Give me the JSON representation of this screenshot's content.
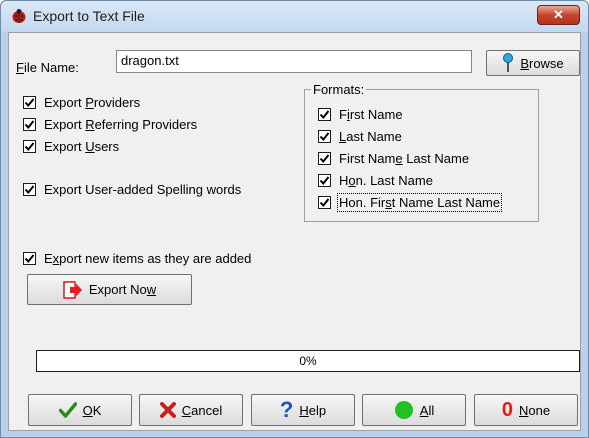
{
  "window": {
    "title": "Export to Text File",
    "close_label": "✕"
  },
  "file": {
    "label_prefix": "",
    "label_accel": "F",
    "label_rest": "ile Name:",
    "value": "dragon.txt"
  },
  "browse": {
    "accel": "B",
    "rest": "rowse"
  },
  "exports": [
    {
      "pre": "Export ",
      "accel": "P",
      "post": "roviders",
      "checked": true
    },
    {
      "pre": "Export ",
      "accel": "R",
      "post": "eferring Providers",
      "checked": true
    },
    {
      "pre": "Export ",
      "accel": "U",
      "post": "sers",
      "checked": true
    },
    {
      "pre": "Export User-added Spellin",
      "accel": "g",
      "post": " words",
      "checked": true
    }
  ],
  "formats": {
    "title": "Formats:",
    "items": [
      {
        "pre": "F",
        "accel": "i",
        "post": "rst Name",
        "checked": true
      },
      {
        "pre": "",
        "accel": "L",
        "post": "ast Name",
        "checked": true
      },
      {
        "pre": "First Nam",
        "accel": "e",
        "post": " Last Name",
        "checked": true
      },
      {
        "pre": "H",
        "accel": "o",
        "post": "n. Last Name",
        "checked": true
      },
      {
        "pre": "Hon. Fir",
        "accel": "s",
        "post": "t Name Last Name",
        "checked": true
      }
    ]
  },
  "export_new": {
    "pre": "E",
    "accel": "x",
    "post": "port new items as they are added",
    "checked": true
  },
  "export_now": {
    "pre": "Export No",
    "accel": "w",
    "post": ""
  },
  "progress": {
    "value": 0,
    "text": "0%"
  },
  "buttons": {
    "ok": {
      "accel": "O",
      "rest": "K"
    },
    "cancel": {
      "accel": "C",
      "rest": "ancel"
    },
    "help": {
      "accel": "H",
      "rest": "elp"
    },
    "all": {
      "accel": "A",
      "rest": "ll"
    },
    "none": {
      "accel": "N",
      "rest": "one"
    }
  },
  "colors": {
    "check": "#000000",
    "ok": "#2e8b1a",
    "cancel": "#c8201a",
    "help": "#1f4fd0",
    "all": "#22c022",
    "none": "#e02010"
  }
}
